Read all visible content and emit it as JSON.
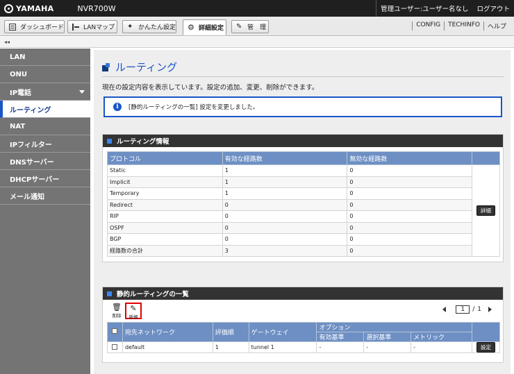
{
  "header": {
    "logo": "YAMAHA",
    "model": "NVR700W",
    "user": "管理ユーザー:ユーザー名なし",
    "logout": "ログアウト"
  },
  "tabs": [
    {
      "label": "ダッシュボード",
      "icon": "dashboard-icon"
    },
    {
      "label": "LANマップ",
      "icon": "lan-map-icon"
    },
    {
      "label": "かんたん設定",
      "icon": "wizard-icon"
    },
    {
      "label": "詳細設定",
      "icon": "gear-icon",
      "active": true
    },
    {
      "label": "管　理",
      "icon": "wrench-icon"
    }
  ],
  "toplinks": [
    "CONFIG",
    "TECHINFO",
    "ヘルプ"
  ],
  "collapse": "◂◂",
  "sidebar": {
    "items": [
      {
        "label": "LAN"
      },
      {
        "label": "ONU"
      },
      {
        "label": "IP電話"
      },
      {
        "label": "ルーティング"
      },
      {
        "label": "NAT"
      },
      {
        "label": "IPフィルター"
      },
      {
        "label": "DNSサーバー"
      },
      {
        "label": "DHCPサーバー"
      },
      {
        "label": "メール通知"
      }
    ]
  },
  "main": {
    "title": "ルーティング",
    "description": "現在の設定内容を表示しています。設定の追加、変更、削除ができます。",
    "notice": "[静的ルーティングの一覧] 設定を変更しました。",
    "routing_info": {
      "heading": "ルーティング情報",
      "headers": [
        "プロトコル",
        "有効な経路数",
        "無効な経路数"
      ],
      "rows": [
        [
          "Static",
          "1",
          "0"
        ],
        [
          "Implicit",
          "1",
          "0"
        ],
        [
          "Temporary",
          "1",
          "0"
        ],
        [
          "Redirect",
          "0",
          "0"
        ],
        [
          "RIP",
          "0",
          "0"
        ],
        [
          "OSPF",
          "0",
          "0"
        ],
        [
          "BGP",
          "0",
          "0"
        ],
        [
          "経路数の合計",
          "3",
          "0"
        ]
      ],
      "detail_button": "詳細"
    },
    "static_list": {
      "heading": "静的ルーティングの一覧",
      "delete_label": "削除",
      "new_label": "新規",
      "pager": {
        "current": "1",
        "separator": "/",
        "total": "1"
      },
      "headers": {
        "network": "宛先ネットワーク",
        "weight": "評価順",
        "gateway": "ゲートウェイ",
        "option": "オプション",
        "valid": "有効基準",
        "select": "選択基準",
        "metric": "メトリック"
      },
      "row": {
        "network": "default",
        "weight": "1",
        "gateway": "tunnel 1",
        "valid": "-",
        "select": "-",
        "metric": "-",
        "setting_button": "設定"
      }
    }
  }
}
